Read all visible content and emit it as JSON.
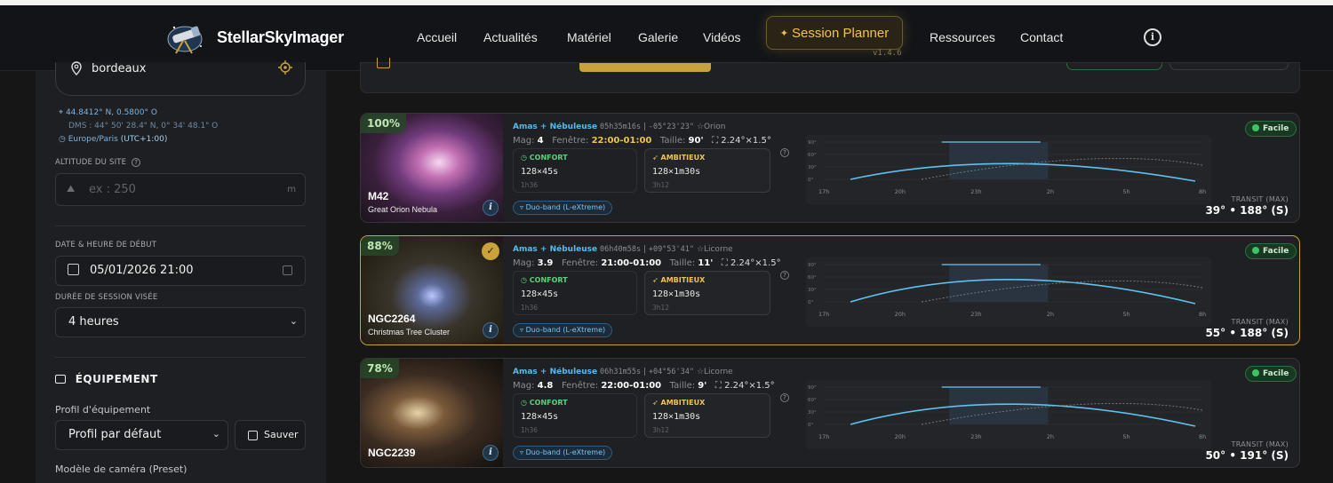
{
  "header": {
    "brand": "StellarSkyImager",
    "nav": [
      "Accueil",
      "Actualités",
      "Matériel",
      "Galerie",
      "Vidéos"
    ],
    "nav_right": [
      "Ressources",
      "Contact"
    ],
    "planner_label": "Session Planner",
    "version": "v1.4.6",
    "colors": {
      "accent": "#c9a23c",
      "bg": "#121418"
    }
  },
  "sidebar": {
    "location_value": "bordeaux",
    "coords": "44.8412° N, 0.5800° O",
    "dms": "DMS : 44° 50' 28.4\" N, 0° 34' 48.1\" O",
    "timezone": "Europe/Paris",
    "utc": "(UTC+1:00)",
    "altitude_label": "ALTITUDE DU SITE",
    "altitude_placeholder": "ex : 250",
    "altitude_unit": "m",
    "date_label": "DATE & HEURE DE DÉBUT",
    "date_value": "05/01/2026 21:00",
    "duration_label": "DURÉE DE SESSION VISÉE",
    "duration_value": "4 heures",
    "equipment_title": "ÉQUIPEMENT",
    "profile_label": "Profil d'équipement",
    "profile_value": "Profil par défaut",
    "save_label": "Sauver",
    "camera_label": "Modèle de caméra (Preset)"
  },
  "labels": {
    "confort": "CONFORT",
    "ambitieux": "AMBITIEUX",
    "transit": "TRANSIT (MAX)",
    "mag": "Mag:",
    "window": "Fenêtre:",
    "size": "Taille:"
  },
  "chart_axes": {
    "x": [
      "17h",
      "20h",
      "23h",
      "2h",
      "5h",
      "8h"
    ],
    "y": [
      "90°",
      "60°",
      "30°",
      "0°"
    ]
  },
  "targets": [
    {
      "score": "100%",
      "name": "M42",
      "subtitle": "Great Orion Nebula",
      "type": "Amas + Nébuleuse",
      "ra": "05h35m16s",
      "dec": "-05°23'23\"",
      "constellation": "Orion",
      "mag": "4",
      "window": "22:00-01:00",
      "size": "90'",
      "fov": "2.24°×1.5°",
      "confort_value": "128×45s",
      "confort_dur": "1h36",
      "amb_value": "128×1m30s",
      "amb_dur": "3h12",
      "filter": "Duo-band (L-eXtreme)",
      "difficulty": "Facile",
      "transit": "39° • 188° (S)",
      "selected": false,
      "max_alt": 39,
      "window_highlight": "gold"
    },
    {
      "score": "88%",
      "name": "NGC2264",
      "subtitle": "Christmas Tree Cluster",
      "type": "Amas + Nébuleuse",
      "ra": "06h40m58s",
      "dec": "+09°53'41\"",
      "constellation": "Licorne",
      "mag": "3.9",
      "window": "21:00-01:00",
      "size": "11'",
      "fov": "2.24°×1.5°",
      "confort_value": "128×45s",
      "confort_dur": "1h36",
      "amb_value": "128×1m30s",
      "amb_dur": "3h12",
      "filter": "Duo-band (L-eXtreme)",
      "difficulty": "Facile",
      "transit": "55° • 188° (S)",
      "selected": true,
      "max_alt": 55,
      "window_highlight": "white"
    },
    {
      "score": "78%",
      "name": "NGC2239",
      "subtitle": "",
      "type": "Amas + Nébuleuse",
      "ra": "06h31m55s",
      "dec": "+04°56'34\"",
      "constellation": "Licorne",
      "mag": "4.8",
      "window": "22:00-01:00",
      "size": "9'",
      "fov": "2.24°×1.5°",
      "confort_value": "128×45s",
      "confort_dur": "1h36",
      "amb_value": "128×1m30s",
      "amb_dur": "3h12",
      "filter": "Duo-band (L-eXtreme)",
      "difficulty": "Facile",
      "transit": "50° • 191° (S)",
      "selected": false,
      "max_alt": 50,
      "window_highlight": "white"
    }
  ]
}
